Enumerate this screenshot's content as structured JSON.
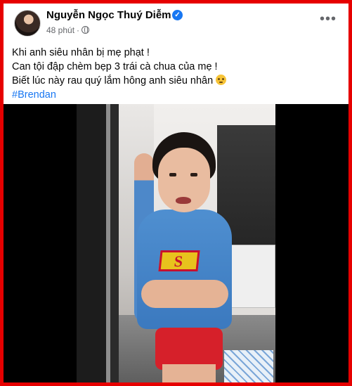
{
  "post": {
    "author_name": "Nguyễn Ngọc Thuý Diễm",
    "verified_icon": "verified-badge-icon",
    "timestamp": "48 phút",
    "separator": "·",
    "audience_icon": "globe-icon",
    "more_label": "•••",
    "text_lines": [
      "Khi anh siêu nhân bị mẹ phạt !",
      "Can tội đập chèm bẹp 3 trái cà chua của mẹ !",
      "Biết lúc này rau quý lắm hông anh siêu nhân"
    ],
    "emoji_icon": "worried-face-emoji-icon",
    "hashtag": "#Brendan"
  },
  "colors": {
    "frame_border": "#e60000",
    "link": "#1877f2",
    "meta": "#65676b",
    "text": "#050505",
    "video_background": "#000000"
  }
}
